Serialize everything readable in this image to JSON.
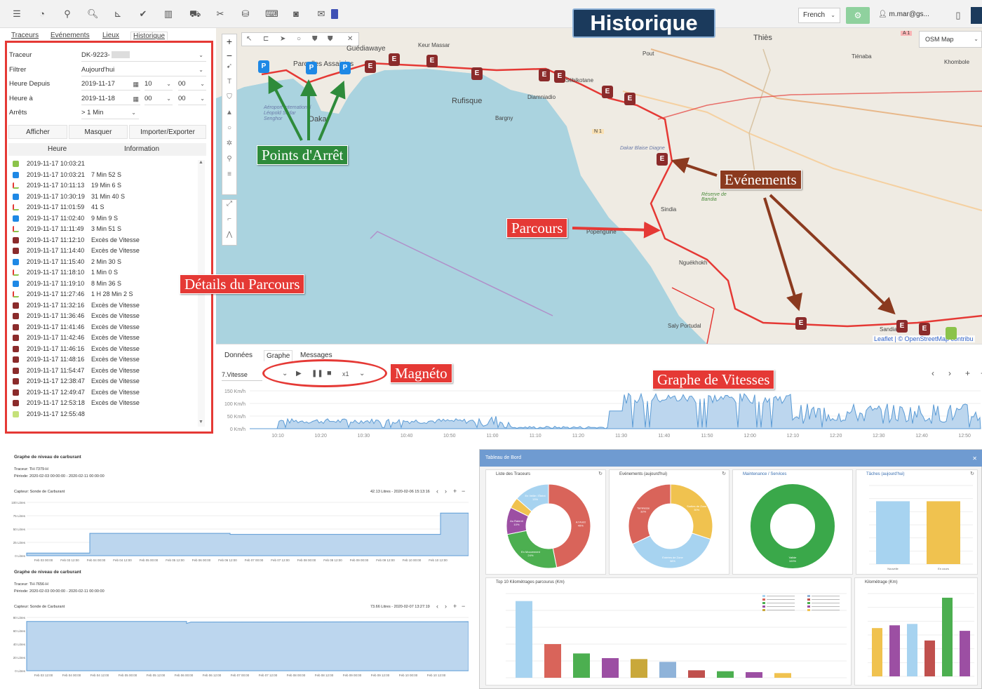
{
  "header": {
    "title": "Historique",
    "language": "French",
    "user": "m.mar@gs...",
    "map_layer": "OSM Map"
  },
  "tabs": [
    "Traceurs",
    "Evénements",
    "Lieux",
    "Historique"
  ],
  "form": {
    "rows": [
      {
        "label": "Traceur",
        "value": "DK-9223-"
      },
      {
        "label": "Filtrer",
        "value": "Aujourd'hui"
      },
      {
        "label": "Heure Depuis",
        "value": "2019-11-17",
        "hour": "10",
        "minute": "00"
      },
      {
        "label": "Heure à",
        "value": "2019-11-18",
        "hour": "00",
        "minute": "00"
      },
      {
        "label": "Arrêts",
        "value": "> 1 Min"
      }
    ],
    "buttons": [
      "Afficher",
      "Masquer",
      "Importer/Exporter"
    ]
  },
  "list": {
    "headers": [
      "Heure",
      "Information"
    ],
    "rows": [
      {
        "time": "2019-11-17 10:03:21",
        "info": "",
        "type": "start"
      },
      {
        "time": "2019-11-17 10:03:21",
        "info": "7 Min 52 S",
        "type": "P"
      },
      {
        "time": "2019-11-17 10:11:13",
        "info": "19 Min 6 S",
        "type": "route"
      },
      {
        "time": "2019-11-17 10:30:19",
        "info": "31 Min 40 S",
        "type": "P"
      },
      {
        "time": "2019-11-17 11:01:59",
        "info": "41 S",
        "type": "route"
      },
      {
        "time": "2019-11-17 11:02:40",
        "info": "9 Min 9 S",
        "type": "P"
      },
      {
        "time": "2019-11-17 11:11:49",
        "info": "3 Min 51 S",
        "type": "route"
      },
      {
        "time": "2019-11-17 11:12:10",
        "info": "Excès de Vitesse",
        "type": "E"
      },
      {
        "time": "2019-11-17 11:14:40",
        "info": "Excès de Vitesse",
        "type": "E"
      },
      {
        "time": "2019-11-17 11:15:40",
        "info": "2 Min 30 S",
        "type": "P"
      },
      {
        "time": "2019-11-17 11:18:10",
        "info": "1 Min 0 S",
        "type": "route"
      },
      {
        "time": "2019-11-17 11:19:10",
        "info": "8 Min 36 S",
        "type": "P"
      },
      {
        "time": "2019-11-17 11:27:46",
        "info": "1 H 28 Min 2 S",
        "type": "route"
      },
      {
        "time": "2019-11-17 11:32:16",
        "info": "Excès de Vitesse",
        "type": "E"
      },
      {
        "time": "2019-11-17 11:36:46",
        "info": "Excès de Vitesse",
        "type": "E"
      },
      {
        "time": "2019-11-17 11:41:46",
        "info": "Excès de Vitesse",
        "type": "E"
      },
      {
        "time": "2019-11-17 11:42:46",
        "info": "Excès de Vitesse",
        "type": "E"
      },
      {
        "time": "2019-11-17 11:46:16",
        "info": "Excès de Vitesse",
        "type": "E"
      },
      {
        "time": "2019-11-17 11:48:16",
        "info": "Excès de Vitesse",
        "type": "E"
      },
      {
        "time": "2019-11-17 11:54:47",
        "info": "Excès de Vitesse",
        "type": "E"
      },
      {
        "time": "2019-11-17 12:38:47",
        "info": "Excès de Vitesse",
        "type": "E"
      },
      {
        "time": "2019-11-17 12:49:47",
        "info": "Excès de Vitesse",
        "type": "E"
      },
      {
        "time": "2019-11-17 12:53:18",
        "info": "Excès de Vitesse",
        "type": "E"
      },
      {
        "time": "2019-11-17 12:55:48",
        "info": "",
        "type": "end"
      }
    ]
  },
  "callouts": {
    "stops": "Points d'Arrêt",
    "events": "Evénements",
    "route": "Parcours",
    "details": "Détails du Parcours",
    "player": "Magnéto",
    "speed_graph": "Graphe de Vitesses"
  },
  "map": {
    "places": [
      "Guédiawaye",
      "Keur Massar",
      "Thiès",
      "Tiénaba",
      "Khombole",
      "Pout",
      "Sébikotane",
      "Diamniadio",
      "Rufisque",
      "Bargny",
      "Parcelles Assainies",
      "Dakar",
      "Sindia",
      "Popenguine",
      "Nguékhokh",
      "Saly Portudal",
      "Sandiara",
      "Dakar Blaise Diagne",
      "Réserve de Bandia",
      "Aéroport International Léopold Sédar Senghor",
      "N 1",
      "A 1"
    ],
    "attribution": "Leaflet | © OpenStreetMap contribu"
  },
  "graph": {
    "tabs": [
      "Données",
      "Graphe",
      "Messages"
    ],
    "selector": "7.Vitesse",
    "speed": "x1",
    "y_ticks": [
      "150 Km/h",
      "100 Km/h",
      "50 Km/h",
      "0 Km/h"
    ],
    "x_ticks": [
      "10:10",
      "10:20",
      "10:30",
      "10:40",
      "10:50",
      "11:00",
      "11:10",
      "11:20",
      "11:30",
      "11:40",
      "11:50",
      "12:00",
      "12:10",
      "12:20",
      "12:30",
      "12:40",
      "12:50"
    ]
  },
  "fuel": [
    {
      "title": "Graphe de niveau de carburant",
      "tracker": "Traceur: TH-7379-H",
      "period": "Période: 2020-02-03 00:00:00 - 2020-02-11 00:00:00",
      "sensor": "Capteur: Sonde de Carburant",
      "reading": "42.13 Litres - 2020-02-06 15:13:16",
      "y_ticks": [
        "100 Litres",
        "75 Litres",
        "50 Litres",
        "25 Litres",
        "0 Litres"
      ],
      "x_ticks": [
        "Feb 03 00:00",
        "Feb 03 12:00",
        "Feb 04 00:00",
        "Feb 04 12:00",
        "Feb 05 00:00",
        "Feb 05 12:00",
        "Feb 06 00:00",
        "Feb 06 12:00",
        "Feb 07 00:00",
        "Feb 07 12:00",
        "Feb 08 00:00",
        "Feb 08 12:00",
        "Feb 09 00:00",
        "Feb 09 12:00",
        "Feb 10 00:00",
        "Feb 10 12:00"
      ]
    },
    {
      "title": "Graphe de niveau de carburant",
      "tracker": "Traceur: TH-7656-H",
      "period": "Période: 2020-02-03 00:00:00 - 2020-02-11 00:00:00",
      "sensor": "Capteur: Sonde de Carburant",
      "reading": "73.66 Litres - 2020-02-07 13:27:19",
      "y_ticks": [
        "80 Litres",
        "60 Litres",
        "40 Litres",
        "20 Litres",
        "0 Litres"
      ],
      "x_ticks": [
        "Feb 03 12:00",
        "Feb 04 00:00",
        "Feb 04 12:00",
        "Feb 05 00:00",
        "Feb 05 12:00",
        "Feb 06 00:00",
        "Feb 06 12:00",
        "Feb 07 00:00",
        "Feb 07 12:00",
        "Feb 08 00:00",
        "Feb 08 12:00",
        "Feb 09 00:00",
        "Feb 09 12:00",
        "Feb 10 00:00",
        "Feb 10 12:00"
      ]
    }
  ],
  "dashboard": {
    "title": "Tableau de Bord",
    "cards": [
      "Liste des Traceurs",
      "Evénements (aujourd'hui)",
      "Maintenance / Services",
      "Tâches (aujourd'hui)",
      "Top 10 Kilométrages parcourus (Km)",
      "Kilométrage (Km)"
    ],
    "donut1": [
      {
        "label": "A l'Arrêt",
        "pct": "45%",
        "color": "#d9645a",
        "value": 45
      },
      {
        "label": "En Mouvement",
        "pct": "24%",
        "color": "#4caf50",
        "value": 24
      },
      {
        "label": "Au Ralenti",
        "pct": "10%",
        "color": "#9c4fa3",
        "value": 10
      },
      {
        "label": "",
        "pct": "",
        "color": "#f0c24f",
        "value": 4
      },
      {
        "label": "En Veille / Éteint",
        "pct": "13%",
        "color": "#a7d3f0",
        "value": 13
      }
    ],
    "donut2": [
      {
        "label": "Sorties de Zone",
        "pct": "30%",
        "color": "#f0c24f",
        "value": 30
      },
      {
        "label": "Entrées de Zone",
        "pct": "38%",
        "color": "#a7d3f0",
        "value": 38
      },
      {
        "label": "Tamiresse",
        "pct": "32%",
        "color": "#d9645a",
        "value": 32
      }
    ],
    "donut3": [
      {
        "label": "Valide",
        "pct": "100%",
        "color": "#3aa84a",
        "value": 100
      }
    ],
    "tasks_bars": [
      {
        "label": "Nouvelle",
        "value": 0.8,
        "color": "#a7d3f0"
      },
      {
        "label": "En cours",
        "value": 0.8,
        "color": "#f0c24f"
      }
    ],
    "top10": [
      {
        "value": 410000,
        "color": "#a7d3f0"
      },
      {
        "value": 180000,
        "color": "#d9645a"
      },
      {
        "value": 130000,
        "color": "#4caf50"
      },
      {
        "value": 105000,
        "color": "#9c4fa3"
      },
      {
        "value": 100000,
        "color": "#c9a83a"
      },
      {
        "value": 85000,
        "color": "#8fb3d9"
      },
      {
        "value": 40000,
        "color": "#c0504d"
      },
      {
        "value": 35000,
        "color": "#4caf50"
      },
      {
        "value": 30000,
        "color": "#9c4fa3"
      },
      {
        "value": 25000,
        "color": "#f0c24f"
      }
    ],
    "km_bars": [
      {
        "value": 350,
        "color": "#f0c24f"
      },
      {
        "value": 370,
        "color": "#9c4fa3"
      },
      {
        "value": 380,
        "color": "#a7d3f0"
      },
      {
        "value": 260,
        "color": "#c0504d"
      },
      {
        "value": 570,
        "color": "#4caf50"
      },
      {
        "value": 330,
        "color": "#9c4fa3"
      }
    ]
  }
}
